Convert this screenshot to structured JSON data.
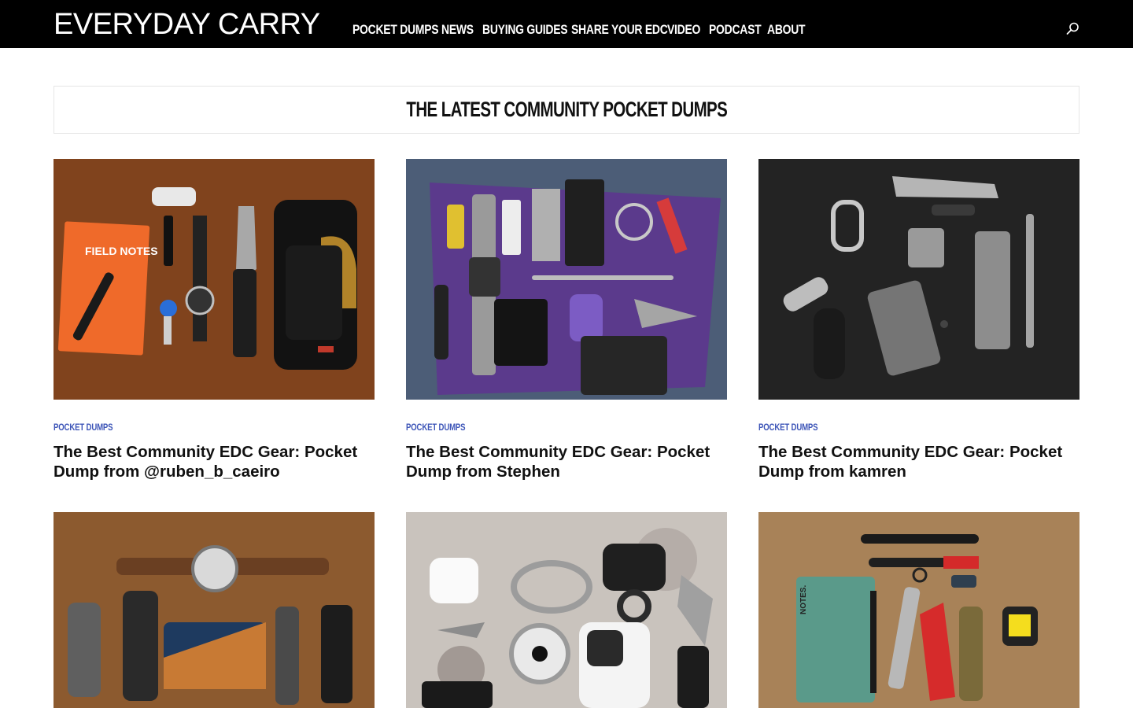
{
  "header": {
    "logo": "EVERYDAY CARRY",
    "nav": [
      "POCKET DUMPS",
      "NEWS",
      "BUYING GUIDES",
      "SHARE YOUR EDC",
      "VIDEO",
      "PODCAST",
      "ABOUT"
    ],
    "search_icon": "search-icon"
  },
  "section": {
    "title": "THE LATEST COMMUNITY POCKET DUMPS"
  },
  "cards": [
    {
      "category": "POCKET DUMPS",
      "title": "The Best Community EDC Gear: Pocket Dump from @ruben_b_caeiro",
      "image_text": "FIELD NOTES"
    },
    {
      "category": "POCKET DUMPS",
      "title": "The Best Community EDC Gear: Pocket Dump from Stephen"
    },
    {
      "category": "POCKET DUMPS",
      "title": "The Best Community EDC Gear: Pocket Dump from kamren"
    },
    {
      "category": "",
      "title": ""
    },
    {
      "category": "",
      "title": ""
    },
    {
      "category": "",
      "title": "",
      "image_text": "NOTES."
    }
  ],
  "colors": {
    "header_bg": "#000000",
    "category": "#3d55b8",
    "text": "#111111",
    "border": "#e6e6e6"
  }
}
